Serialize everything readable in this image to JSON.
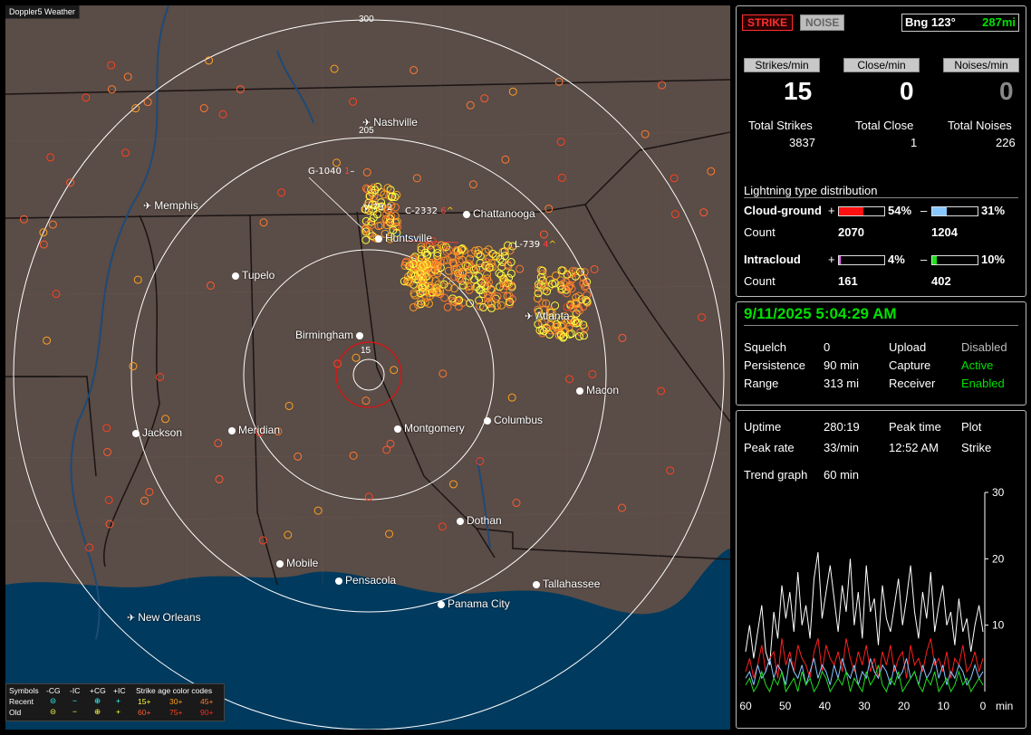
{
  "app": {
    "title": "Doppler5 Weather"
  },
  "map": {
    "rings": [
      {
        "label": "15"
      },
      {
        "label": "205"
      },
      {
        "label": "300"
      }
    ],
    "cities": [
      {
        "name": "Nashville",
        "kind": "plane"
      },
      {
        "name": "Memphis",
        "kind": "plane"
      },
      {
        "name": "Chattanooga",
        "kind": "dot"
      },
      {
        "name": "Huntsville",
        "kind": "dot"
      },
      {
        "name": "Tupelo",
        "kind": "dot"
      },
      {
        "name": "Atlanta",
        "kind": "plane"
      },
      {
        "name": "Birmingham",
        "kind": "dot"
      },
      {
        "name": "Macon",
        "kind": "dot"
      },
      {
        "name": "Jackson",
        "kind": "dot"
      },
      {
        "name": "Meridian",
        "kind": "dot"
      },
      {
        "name": "Montgomery",
        "kind": "dot"
      },
      {
        "name": "Columbus",
        "kind": "dot"
      },
      {
        "name": "Dothan",
        "kind": "dot"
      },
      {
        "name": "Mobile",
        "kind": "dot"
      },
      {
        "name": "Pensacola",
        "kind": "dot"
      },
      {
        "name": "Tallahassee",
        "kind": "dot"
      },
      {
        "name": "Panama City",
        "kind": "dot"
      },
      {
        "name": "New Orleans",
        "kind": "plane"
      }
    ],
    "markers": [
      {
        "text": "G-1040",
        "extra": "1",
        "tail": "–"
      },
      {
        "text": "V-79",
        "extra": "2",
        "tail": ""
      },
      {
        "text": "C-2332",
        "extra": "6",
        "tail": "^"
      },
      {
        "text": "L-739",
        "extra": "4",
        "tail": "^"
      }
    ]
  },
  "legend": {
    "symbols_label": "Symbols",
    "headers": [
      "-CG",
      "-IC",
      "+CG",
      "+IC"
    ],
    "age_title": "Strike age color codes",
    "recent_label": "Recent",
    "old_label": "Old",
    "recent_symbols": [
      "⊝",
      "−",
      "⊕",
      "+"
    ],
    "old_symbols": [
      "⊝",
      "−",
      "⊕",
      "+"
    ],
    "recent_ages": [
      "15+",
      "30+",
      "45+"
    ],
    "old_ages": [
      "60+",
      "75+",
      "90+"
    ],
    "age_colors": [
      "#ffff40",
      "#ffa020",
      "#ff7a30",
      "#ff5a30",
      "#ff4020",
      "#ff2a20"
    ]
  },
  "top": {
    "strike_btn": "STRIKE",
    "noise_btn": "NOISE",
    "bearing": "Bng 123°",
    "distance": "287mi"
  },
  "stats": {
    "tabs": [
      "Strikes/min",
      "Close/min",
      "Noises/min"
    ],
    "values": [
      "15",
      "0",
      "0"
    ],
    "totals_labels": [
      "Total Strikes",
      "Total Close",
      "Total Noises"
    ],
    "totals_values": [
      "3837",
      "1",
      "226"
    ]
  },
  "distribution": {
    "title": "Lightning type distribution",
    "rows": [
      {
        "label": "Cloud-ground",
        "pos_pct": "54%",
        "neg_pct": "31%",
        "pos_fill": 0.54,
        "neg_fill": 0.31,
        "pos_color": "#ff1010",
        "neg_color": "#88c8ff"
      },
      {
        "label": "Intracloud",
        "pos_pct": "4%",
        "neg_pct": "10%",
        "pos_fill": 0.04,
        "neg_fill": 0.1,
        "pos_color": "#ff60ff",
        "neg_color": "#20e020"
      }
    ],
    "count_label": "Count",
    "counts": [
      [
        "2070",
        "1204"
      ],
      [
        "161",
        "402"
      ]
    ],
    "plus": "+",
    "minus": "–"
  },
  "status": {
    "datetime": "9/11/2025 5:04:29 AM",
    "rows": [
      [
        "Squelch",
        "0",
        "Upload",
        "Disabled"
      ],
      [
        "Persistence",
        "90 min",
        "Capture",
        "Active"
      ],
      [
        "Range",
        "313 mi",
        "Receiver",
        "Enabled"
      ]
    ]
  },
  "trend": {
    "uptime_label": "Uptime",
    "uptime": "280:19",
    "peak_time_label": "Peak time",
    "plot_label": "Plot",
    "peak_rate_label": "Peak rate",
    "peak_rate": "33/min",
    "peak_time": "12:52 AM",
    "plot_value": "Strike",
    "trend_label": "Trend graph",
    "trend_value": "60 min"
  },
  "chart_data": {
    "type": "line",
    "xlabel": "min",
    "x_ticks": [
      "60",
      "50",
      "40",
      "30",
      "20",
      "10",
      "0"
    ],
    "y_ticks": [
      "30",
      "20",
      "10"
    ],
    "ylim": [
      0,
      30
    ],
    "xlim": [
      60,
      0
    ],
    "series": [
      {
        "color": "#ffffff",
        "values": [
          6,
          10,
          5,
          9,
          13,
          6,
          4,
          12,
          8,
          16,
          11,
          15,
          9,
          18,
          10,
          13,
          8,
          17,
          21,
          11,
          15,
          19,
          14,
          9,
          16,
          12,
          20,
          10,
          15,
          8,
          19,
          12,
          14,
          7,
          16,
          11,
          9,
          13,
          17,
          10,
          14,
          19,
          12,
          8,
          15,
          11,
          18,
          9,
          13,
          16,
          10,
          12,
          7,
          14,
          9,
          11,
          6,
          10,
          13,
          9
        ]
      },
      {
        "color": "#ff2020",
        "values": [
          3,
          5,
          2,
          4,
          7,
          3,
          5,
          6,
          2,
          8,
          4,
          6,
          3,
          7,
          5,
          4,
          2,
          6,
          8,
          3,
          7,
          5,
          4,
          6,
          3,
          8,
          5,
          3,
          6,
          4,
          7,
          3,
          5,
          2,
          6,
          4,
          7,
          3,
          5,
          6,
          2,
          7,
          4,
          5,
          3,
          6,
          8,
          4,
          5,
          3,
          6,
          2,
          5,
          4,
          7,
          3,
          4,
          6,
          3,
          5
        ]
      },
      {
        "color": "#88c8ff",
        "values": [
          2,
          3,
          1,
          4,
          2,
          3,
          5,
          2,
          4,
          3,
          1,
          5,
          3,
          2,
          4,
          1,
          3,
          5,
          2,
          4,
          3,
          1,
          4,
          2,
          5,
          3,
          2,
          4,
          1,
          3,
          2,
          5,
          3,
          2,
          4,
          3,
          1,
          4,
          2,
          3,
          5,
          2,
          3,
          1,
          4,
          2,
          3,
          5,
          2,
          4,
          1,
          3,
          2,
          4,
          3,
          1,
          2,
          4,
          2,
          3
        ]
      },
      {
        "color": "#20e020",
        "values": [
          1,
          2,
          0,
          1,
          3,
          1,
          0,
          2,
          1,
          3,
          0,
          1,
          2,
          0,
          3,
          1,
          2,
          0,
          1,
          3,
          2,
          0,
          1,
          2,
          1,
          3,
          0,
          2,
          1,
          0,
          3,
          1,
          2,
          4,
          1,
          0,
          2,
          1,
          3,
          0,
          1,
          2,
          3,
          1,
          0,
          2,
          1,
          3,
          0,
          1,
          2,
          0,
          1,
          3,
          1,
          2,
          0,
          1,
          2,
          1
        ]
      }
    ]
  }
}
